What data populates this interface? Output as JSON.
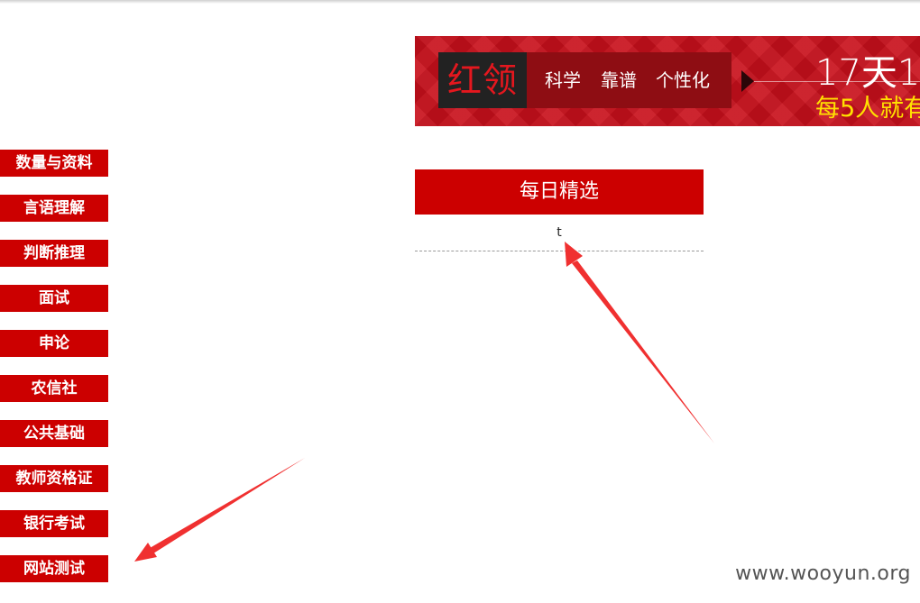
{
  "banner": {
    "logo": "红领",
    "tags": [
      "科学",
      "靠谱",
      "个性化"
    ],
    "headline": "17天1",
    "subline": "每5人就有"
  },
  "sidebar": {
    "items": [
      {
        "label": "数量与资料"
      },
      {
        "label": "言语理解"
      },
      {
        "label": "判断推理"
      },
      {
        "label": "面试"
      },
      {
        "label": "申论"
      },
      {
        "label": "农信社"
      },
      {
        "label": "公共基础"
      },
      {
        "label": "教师资格证"
      },
      {
        "label": "银行考试"
      },
      {
        "label": "网站测试"
      }
    ]
  },
  "daily": {
    "title": "每日精选",
    "items": [
      {
        "text": "t"
      }
    ]
  },
  "watermark": "www.wooyun.org",
  "colors": {
    "accent_red": "#cc0000",
    "banner_red": "#c8101b",
    "banner_yellow": "#ffe100",
    "annotation_red": "#f03030"
  }
}
